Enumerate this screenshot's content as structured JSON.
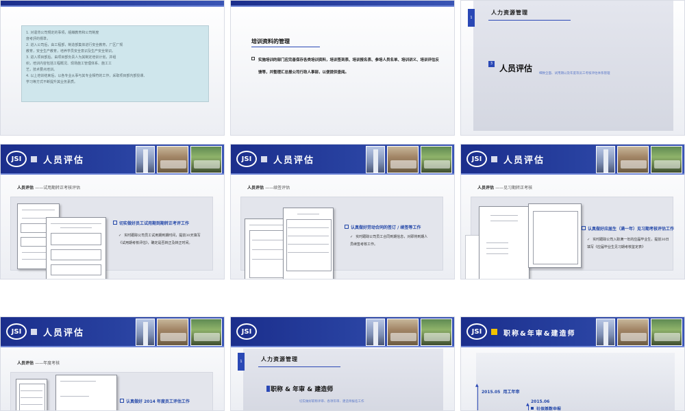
{
  "logo_text": "JSI",
  "s1": {
    "lines": [
      "1. 对違背公司規定的事項，組織教育和公司制度",
      "度考評的標準，",
      "2. 进入公司后，由工程部，制造部集体进行安全教育，厂区厂规",
      "教育，安全生产教育，培养学员安全意识及生产安全常识。",
      "3. 进入项目部后，由项目部负责人为其制定培训计划，并组",
      "织，培训内容包括工程概况、现场施工管理体系、施工工",
      "艺，技术要点培训。",
      "4. 以上培训结束后，以各专业从事与其专业相符的工作，采取项目部内部授课、",
      "学习等方式不断提升其业务素质。"
    ]
  },
  "s2": {
    "title": "培训资料的管理",
    "body": "实施培训的部门应完善保存各类培训资料，培训签到表、培训报名表、参培人员名单、培训讲义、培训评估反馈等，并整理汇总报公司行政人事部，以便提供查阅。"
  },
  "s3": {
    "tag": "1",
    "header": "人力资源管理",
    "num": "3",
    "title": "人员评估",
    "desc": "细致全面、试用期以及年度等员工考核评估体系管理"
  },
  "s4": {
    "header": "人员评估",
    "sub_a": "人员评估",
    "sub_b": "——试用期转正考核评估",
    "point": "切实做好员工试用期到期转正考评工作",
    "detail": "实时跟踪公司员工试用期到期时间，提前30天填写《试用期考核评估》，确定是否转正及转正时间。"
  },
  "s5": {
    "header": "人员评估",
    "sub_a": "人员评估",
    "sub_b": "——续签评估",
    "point": "认真做好劳动合同的签订 / 续签等工作",
    "detail": "实时跟踪公司员工合同到期信息，对即将到期人员续签考核工作。"
  },
  "s6": {
    "header": "人员评估",
    "sub_a": "人员评估",
    "sub_b": "——见习期转正考核",
    "point": "认真做好应届生（满一年）见习期考核评估工作",
    "detail": "实时跟踪公司入职满一年的应届毕业生，提前30日填写《应届毕业生见习期考核鉴定表》"
  },
  "s7": {
    "header": "人员评估",
    "sub_a": "人员评估",
    "sub_b": "——年度考核",
    "point": "认真做好 2014 年度员工评估工作"
  },
  "s8": {
    "tag": "1",
    "header": "人力资源管理",
    "title": "职称 & 年审 & 建造师",
    "desc": "切实做好职称评审、各项年审、建造师报名工作"
  },
  "s9": {
    "header": "职称&年审&建造师",
    "t1": "2015.05  用工年审",
    "t2": "2015.06",
    "t3": "社保基数申报"
  },
  "colors": {
    "brand_blue": "#1b2e8c",
    "accent_blue": "#2347a8",
    "panel_teal": "#cfe6ec"
  }
}
